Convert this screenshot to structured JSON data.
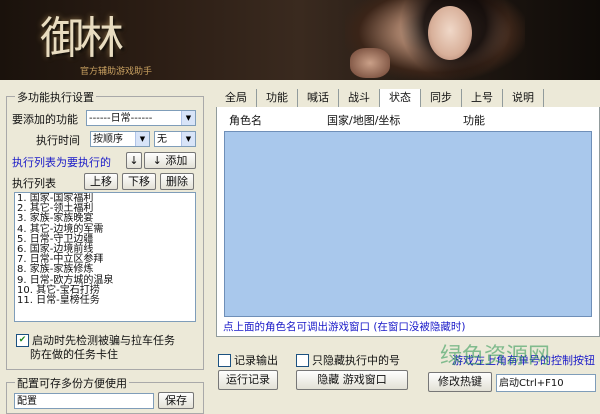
{
  "banner": {
    "logo_text": "御林",
    "logo_sub": "官方辅助游戏助手"
  },
  "left_panel": {
    "group_title": "多功能执行设置",
    "add_func_label": "要添加的功能",
    "add_func_value": "------日常------",
    "exec_time_label": "执行时间",
    "exec_order_value": "按顺序",
    "exec_time_value": "无",
    "exec_list_hint": "执行列表为要执行的",
    "down_arrow_label": "↓",
    "add_label": "添加",
    "exec_list_label": "执行列表",
    "up_btn": "上移",
    "down_btn": "下移",
    "delete_btn": "删除",
    "exec_items": [
      "1. 国家-国家福利",
      "2. 其它-领土福利",
      "3. 家族-家族晚宴",
      "4. 其它-边境的军需",
      "5. 日常-守卫边疆",
      "6. 国家-边境前线",
      "7. 日常-中立区参拜",
      "8. 家族-家族修炼",
      "9. 日常-欧方城的温泉",
      "10. 其它-宝石打捞",
      "11. 日常-皇榜任务"
    ],
    "startup_check_label": "启动时先检测被骗与拉车任务",
    "startup_check_label2": "防在做的任务卡住",
    "config_group_title": "配置可存多份方便使用",
    "config_row_text": "配置",
    "save_btn": "保存"
  },
  "right_panel": {
    "tabs": [
      "全局",
      "功能",
      "喊话",
      "战斗",
      "状态",
      "同步",
      "上号",
      "说明"
    ],
    "active_tab": 4,
    "col_headers": [
      "角色名",
      "国家/地图/坐标",
      "功能"
    ],
    "hint_text": "点上面的角色名可调出游戏窗口 (在窗口没被隐藏时)",
    "record_output_label": "记录输出",
    "hide_exec_label": "只隐藏执行中的号",
    "run_log_btn": "运行记录",
    "hide_window_btn": "隐藏 游戏窗口",
    "game_hint": "游戏左上角有单号的控制按钮",
    "modify_hotkey_btn": "修改热键",
    "start_hotkey": "启动Ctrl+F10"
  },
  "watermark": "绿色资源网"
}
